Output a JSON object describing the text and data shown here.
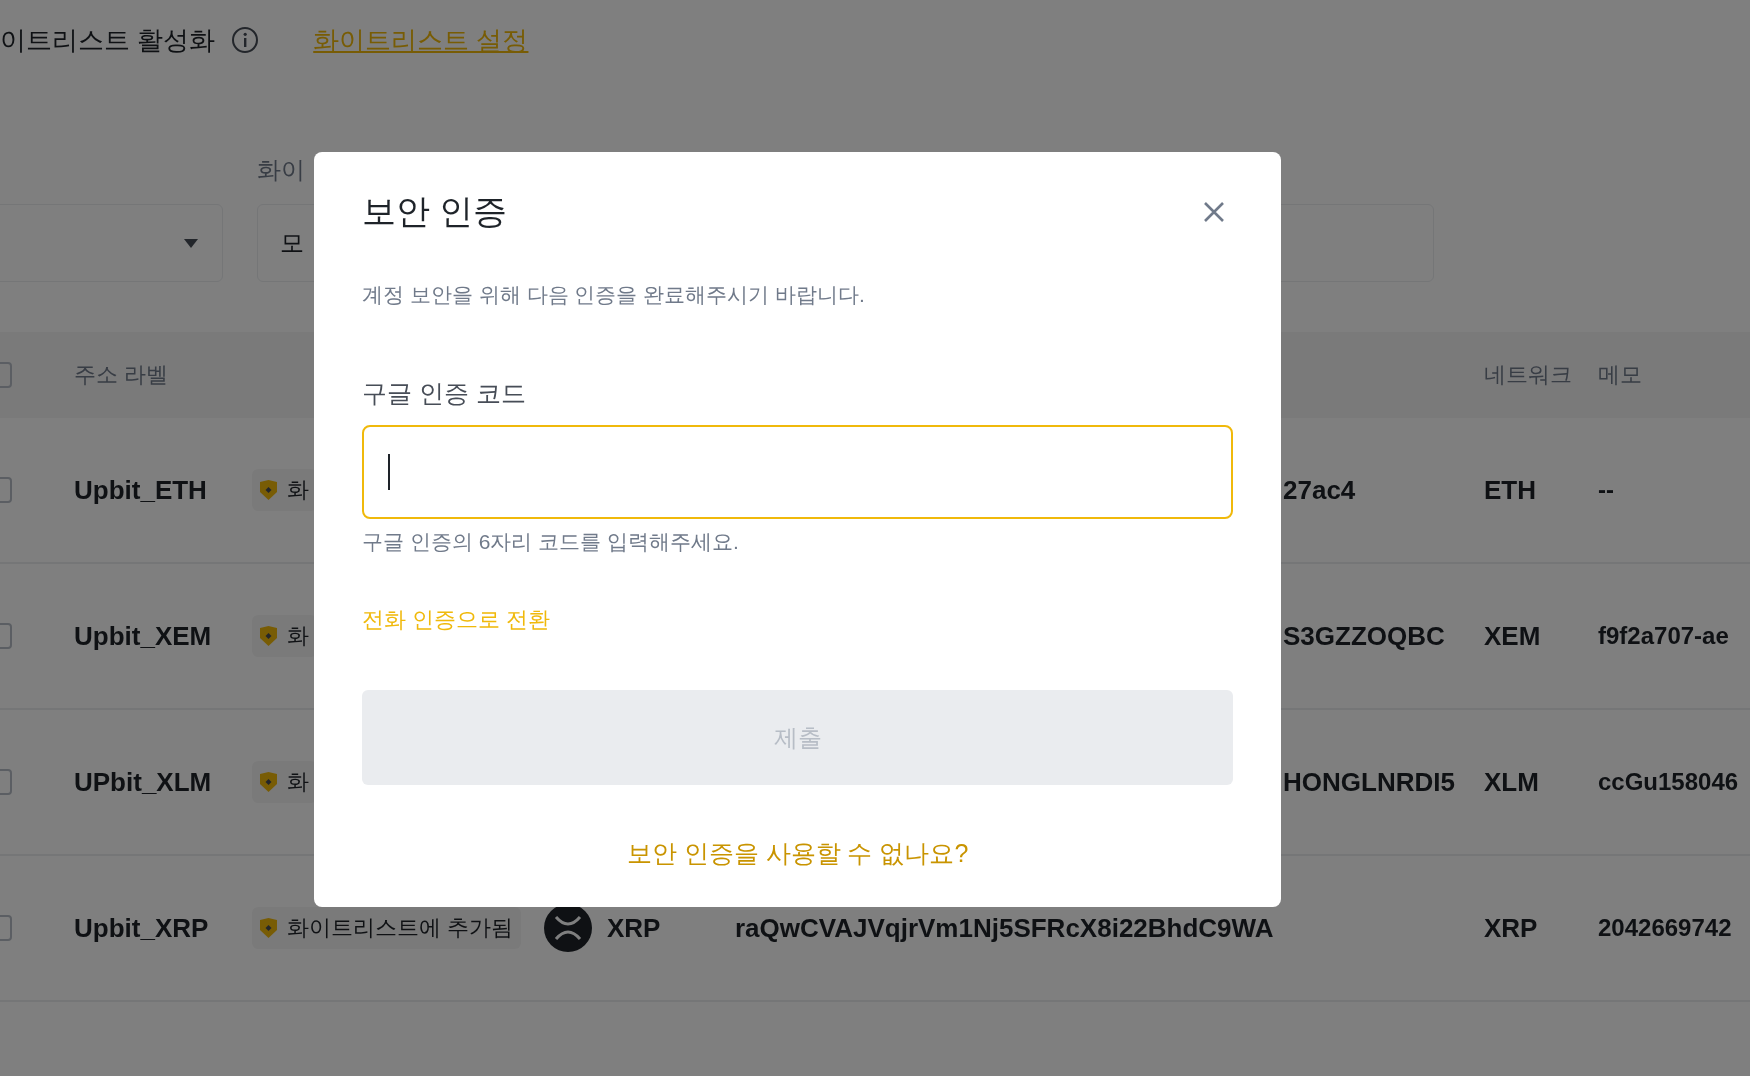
{
  "whitelist": {
    "toggle_label": "이트리스트 활성화",
    "settings_link": "화이트리스트 설정"
  },
  "filters": {
    "label": "화이",
    "value": "모"
  },
  "table": {
    "columns": {
      "address_label": "주소 라벨",
      "network": "네트워크",
      "memo": "메모"
    },
    "select_all_checked": false,
    "rows": [
      {
        "checked": false,
        "label": "Upbit_ETH",
        "tag": "화",
        "address": "27ac4",
        "network": "ETH",
        "memo": "--"
      },
      {
        "checked": false,
        "label": "Upbit_XEM",
        "tag": "화",
        "address": "S3GZZOQBC",
        "network": "XEM",
        "memo": "f9f2a707-ae"
      },
      {
        "checked": false,
        "label": "UPbit_XLM",
        "tag": "화",
        "address": "HONGLNRDI5",
        "network": "XLM",
        "memo": "ccGu158046"
      },
      {
        "label": "Upbit_XRP",
        "tag": "화이트리스트에 추가됨",
        "coin": {
          "kind": "xrp",
          "name": "XRP"
        },
        "address": "raQwCVAJVqjrVm1Nj5SFRcX8i22BhdC9WA",
        "network": "XRP",
        "memo": "2042669742",
        "checked": false
      }
    ]
  },
  "dialog": {
    "title": "보안 인증",
    "description": "계정 보안을 위해 다음 인증을 완료해주시기 바랍니다.",
    "field_label": "구글 인증 코드",
    "field_focused": true,
    "helper": "구글 인증의 6자리 코드를 입력해주세요.",
    "switch_link": "전화 인증으로 전환",
    "submit": {
      "label": "제출",
      "disabled": true
    },
    "help_link": "보안 인증을 사용할 수 없나요?"
  }
}
